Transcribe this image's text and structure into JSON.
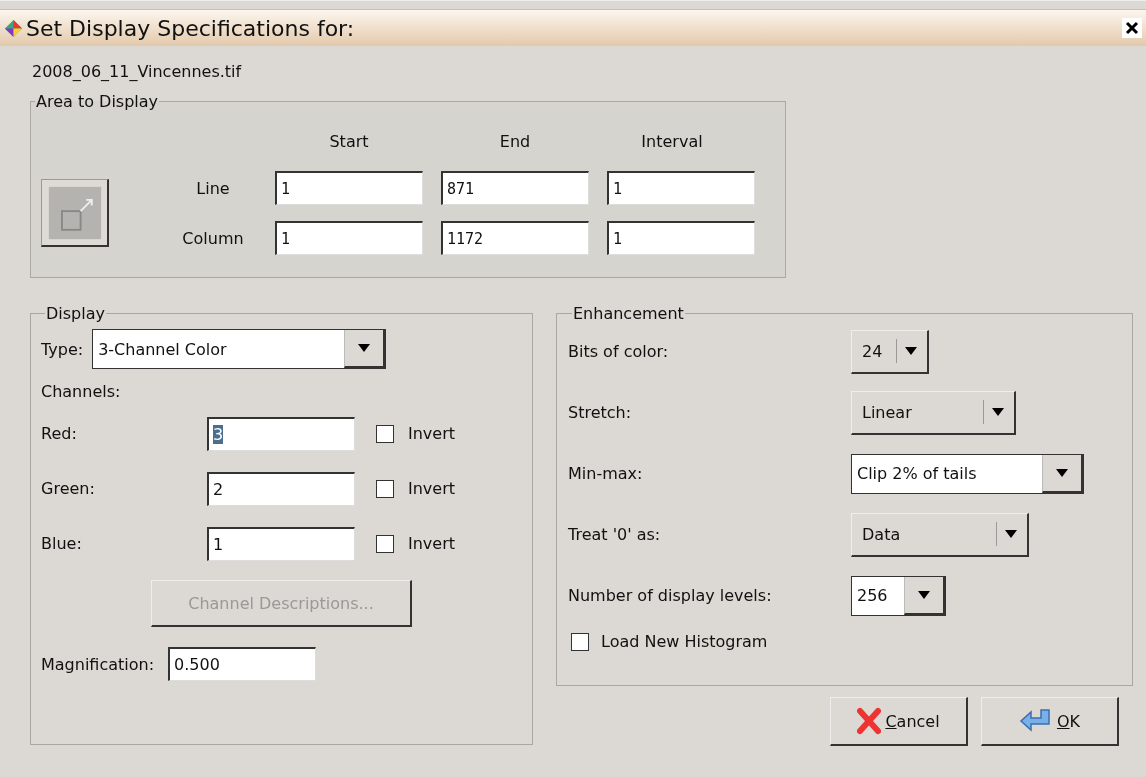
{
  "window": {
    "title": "Set Display Specifications for:"
  },
  "filename": "2008_06_11_Vincennes.tif",
  "area": {
    "title": "Area to Display",
    "columns": [
      "Start",
      "End",
      "Interval"
    ],
    "rows": [
      {
        "label": "Line",
        "values": [
          "1",
          "871",
          "1"
        ]
      },
      {
        "label": "Column",
        "values": [
          "1",
          "1172",
          "1"
        ]
      }
    ]
  },
  "display": {
    "title": "Display",
    "type_label": "Type:",
    "type_value": "3-Channel Color",
    "channels_label": "Channels:",
    "channels": [
      {
        "label": "Red:",
        "value": "3",
        "text_selected": true,
        "invert_label": "Invert",
        "checked": false
      },
      {
        "label": "Green:",
        "value": "2",
        "text_selected": false,
        "invert_label": "Invert",
        "checked": false
      },
      {
        "label": "Blue:",
        "value": "1",
        "text_selected": false,
        "invert_label": "Invert",
        "checked": false
      }
    ],
    "descriptions_button": {
      "label": "Channel Descriptions...",
      "disabled": true
    },
    "magnification_label": "Magnification:",
    "magnification": "0.500"
  },
  "enhancement": {
    "title": "Enhancement",
    "options": [
      {
        "label": "Bits of color:",
        "value": "24",
        "kind": "button"
      },
      {
        "label": "Stretch:",
        "value": "Linear",
        "kind": "button"
      },
      {
        "label": "Min-max:",
        "value": "Clip 2% of tails",
        "kind": "entry"
      },
      {
        "label": "Treat '0' as:",
        "value": "Data",
        "kind": "button"
      },
      {
        "label": "Number of display levels:",
        "value": "256",
        "kind": "entry"
      }
    ],
    "histogram": {
      "label": "Load New Histogram",
      "checked": false
    }
  },
  "buttons": [
    {
      "label": "Cancel",
      "kind": "cancel"
    },
    {
      "label": "OK",
      "kind": "ok"
    }
  ]
}
